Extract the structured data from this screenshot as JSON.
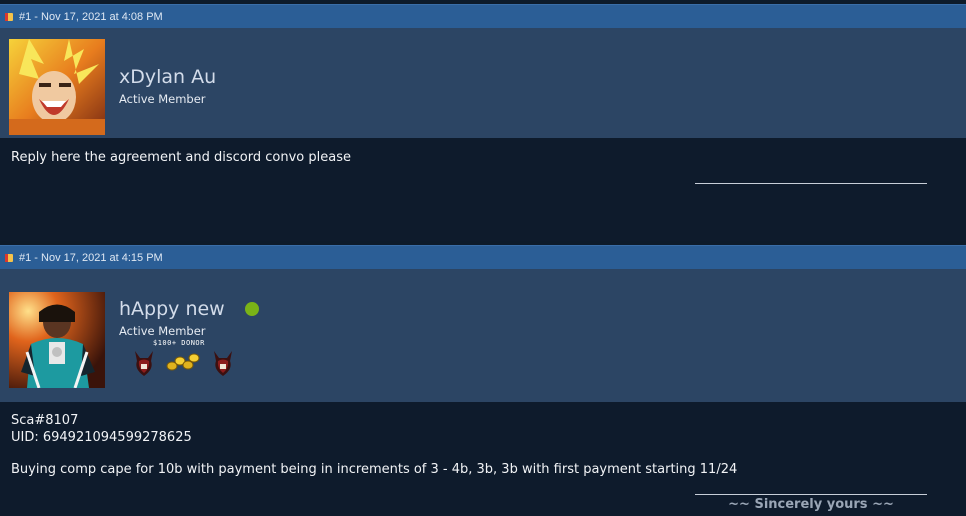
{
  "posts": [
    {
      "header": "#1 - Nov 17, 2021 at 4:08 PM",
      "username": "xDylan Au",
      "user_title": "Active Member",
      "body_lines": [
        "Reply here the agreement and discord convo please"
      ]
    },
    {
      "header": "#1 - Nov 17, 2021 at 4:15 PM",
      "username": "hAppy new",
      "user_title": "Active Member",
      "badges": {
        "donor_label": "$100+ DONOR"
      },
      "body_lines": [
        "Sca#8107",
        "UID: 694921094599278625",
        "",
        "Buying comp cape for 10b with payment being in increments of 3 - 4b, 3b, 3b with first payment starting 11/24"
      ],
      "signature": "~~ Sincerely yours ~~"
    }
  ],
  "colors": {
    "header_bg": "#2b5e96",
    "userbar_bg": "#2c4564",
    "body_bg": "#0e1b2c",
    "online": "#7ab317"
  }
}
